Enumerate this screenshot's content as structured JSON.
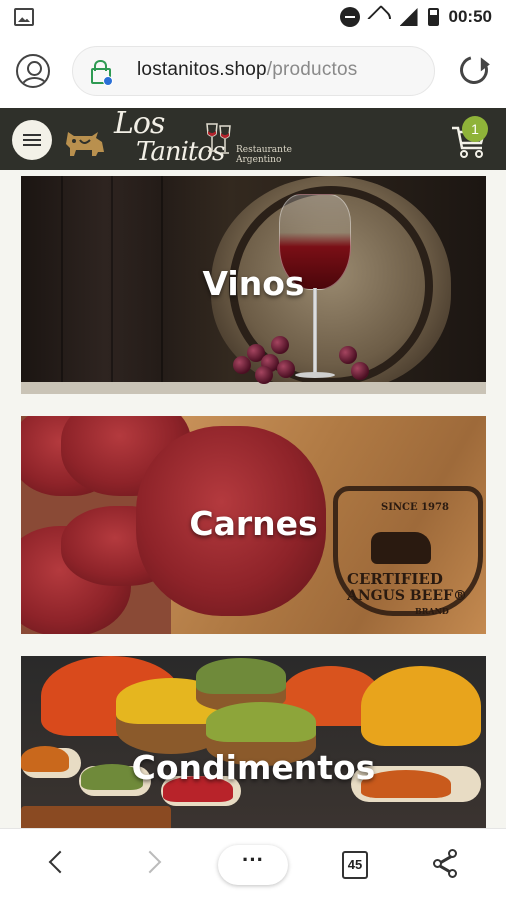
{
  "status_bar": {
    "time": "00:50",
    "icons": [
      "gallery-icon",
      "do-not-disturb-icon",
      "wifi-icon",
      "signal-icon",
      "battery-icon"
    ]
  },
  "browser": {
    "url_domain": "lostanitos.shop",
    "url_path": "/productos",
    "tab_count": "45",
    "more_label": "···"
  },
  "site_header": {
    "logo_line1": "Los",
    "logo_line2": "Tanitos",
    "logo_tagline": "Restaurante Argentino",
    "cart_count": "1",
    "colors": {
      "header_bg": "#2f302a",
      "badge": "#8fb339"
    }
  },
  "categories": [
    {
      "label": "Vinos"
    },
    {
      "label": "Carnes",
      "stamp_top": "SINCE 1978",
      "stamp_line1": "CERTIFIED",
      "stamp_line2": "ANGUS BEEF",
      "stamp_mark": "®",
      "stamp_bottom": "BRAND"
    },
    {
      "label": "Condimentos"
    }
  ]
}
